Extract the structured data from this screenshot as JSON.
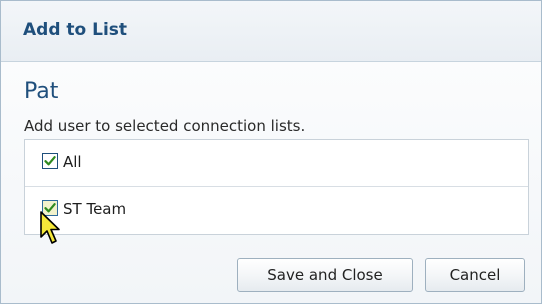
{
  "dialog": {
    "title": "Add to List"
  },
  "content": {
    "user_name": "Pat",
    "instruction": "Add user to selected connection lists."
  },
  "lists": [
    {
      "label": "All",
      "checked": true
    },
    {
      "label": "ST Team",
      "checked": true
    }
  ],
  "buttons": {
    "save_and_close": "Save and Close",
    "cancel": "Cancel"
  },
  "colors": {
    "title": "#1f4f7c",
    "checkmark": "#2f8a1f",
    "hover_checkbox_bg": "#f2f2cc"
  },
  "icons": {
    "checkbox_checked": "checkbox-checked-icon",
    "pointer": "mouse-pointer-icon"
  }
}
